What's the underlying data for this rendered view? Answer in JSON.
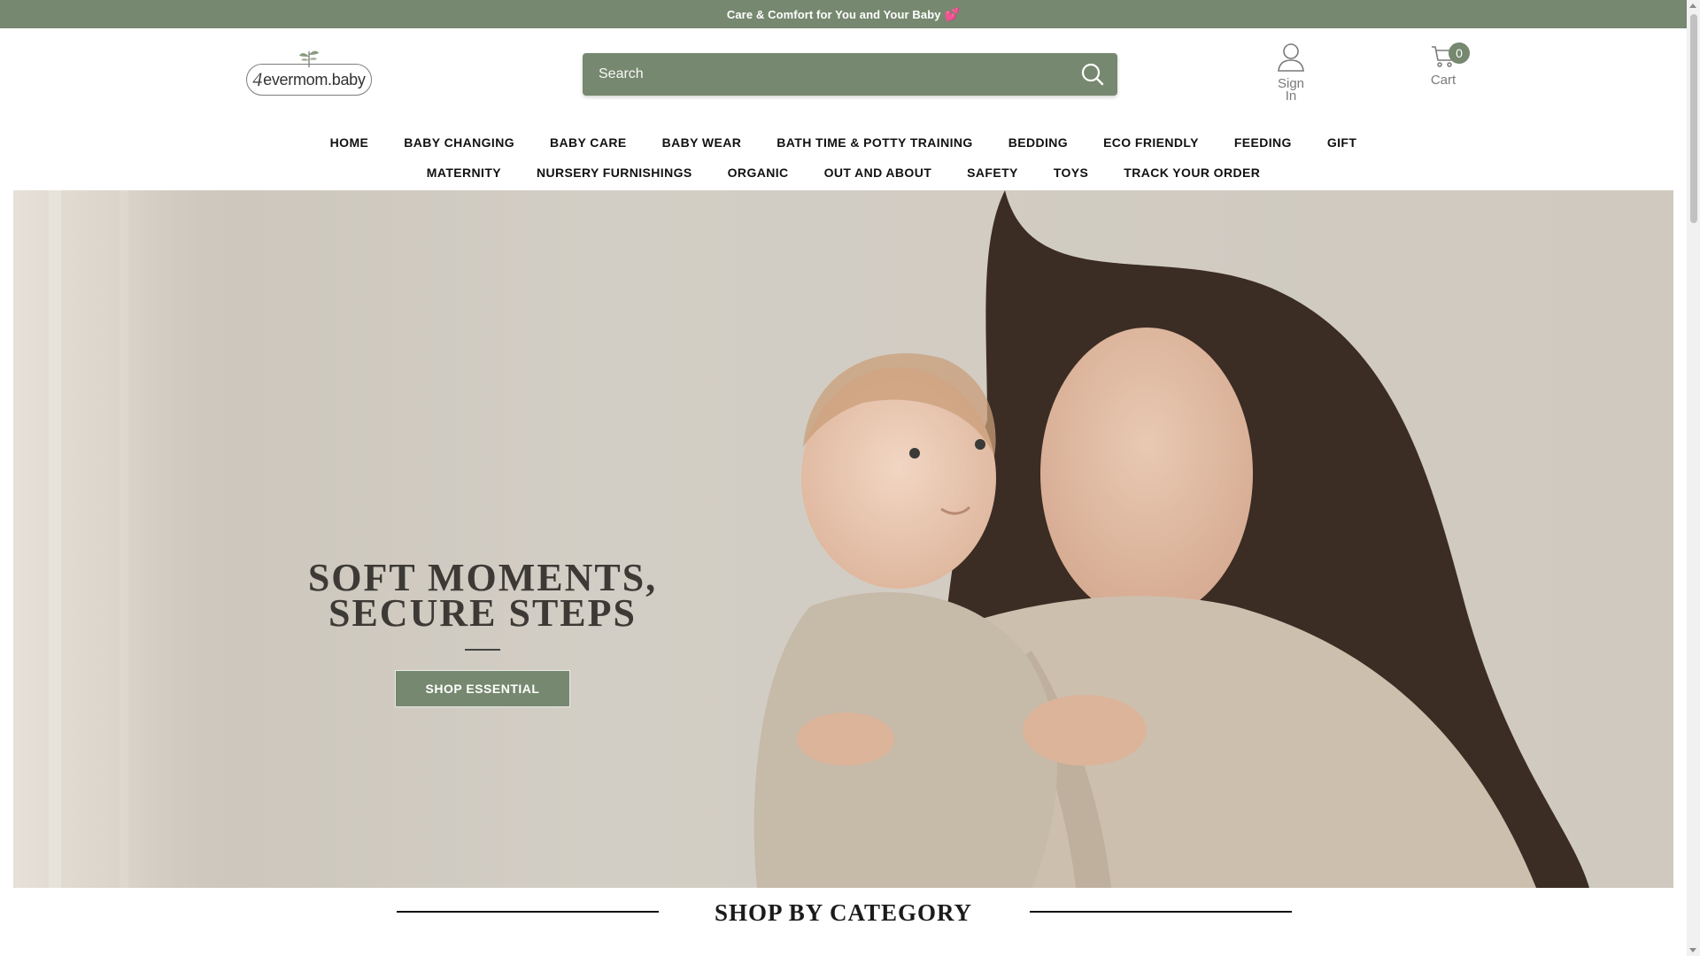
{
  "announcement": {
    "text": "Care & Comfort for You and Your Baby",
    "heart": "💕"
  },
  "brand": {
    "logo_prefix": "4",
    "logo_text": "evermom.baby",
    "accent": "#76886f"
  },
  "search": {
    "placeholder": "Search",
    "icon": "search-icon"
  },
  "account": {
    "label": "Sign In",
    "icon": "user-icon"
  },
  "cart": {
    "label": "Cart",
    "count": "0",
    "icon": "cart-icon"
  },
  "nav": {
    "row1": [
      "HOME",
      "BABY CHANGING",
      "BABY CARE",
      "BABY WEAR",
      "BATH TIME & POTTY TRAINING",
      "BEDDING",
      "ECO FRIENDLY",
      "FEEDING",
      "GIFT"
    ],
    "row2": [
      "MATERNITY",
      "NURSERY FURNISHINGS",
      "ORGANIC",
      "OUT AND ABOUT",
      "SAFETY",
      "TOYS",
      "TRACK YOUR ORDER"
    ]
  },
  "hero": {
    "title_line1": "SOFT MOMENTS,",
    "title_line2": "SECURE STEPS",
    "button": "SHOP ESSENTIAL"
  },
  "section": {
    "title": "SHOP BY CATEGORY"
  }
}
